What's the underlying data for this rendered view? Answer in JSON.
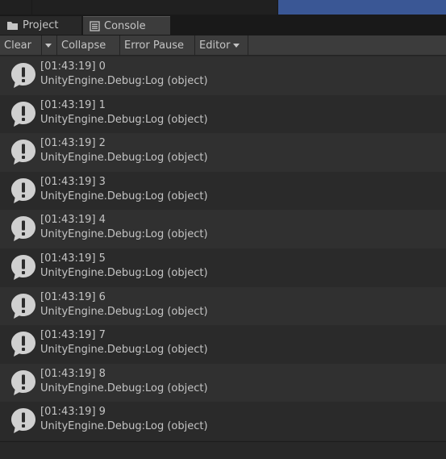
{
  "tabs": [
    {
      "label": "Project",
      "icon": "folder-icon",
      "active": false
    },
    {
      "label": "Console",
      "icon": "console-icon",
      "active": true
    }
  ],
  "toolbar": {
    "clear_label": "Clear",
    "collapse_label": "Collapse",
    "error_pause_label": "Error Pause",
    "editor_label": "Editor"
  },
  "logs": [
    {
      "line1": "[01:43:19] 0",
      "line2": "UnityEngine.Debug:Log (object)"
    },
    {
      "line1": "[01:43:19] 1",
      "line2": "UnityEngine.Debug:Log (object)"
    },
    {
      "line1": "[01:43:19] 2",
      "line2": "UnityEngine.Debug:Log (object)"
    },
    {
      "line1": "[01:43:19] 3",
      "line2": "UnityEngine.Debug:Log (object)"
    },
    {
      "line1": "[01:43:19] 4",
      "line2": "UnityEngine.Debug:Log (object)"
    },
    {
      "line1": "[01:43:19] 5",
      "line2": "UnityEngine.Debug:Log (object)"
    },
    {
      "line1": "[01:43:19] 6",
      "line2": "UnityEngine.Debug:Log (object)"
    },
    {
      "line1": "[01:43:19] 7",
      "line2": "UnityEngine.Debug:Log (object)"
    },
    {
      "line1": "[01:43:19] 8",
      "line2": "UnityEngine.Debug:Log (object)"
    },
    {
      "line1": "[01:43:19] 9",
      "line2": "UnityEngine.Debug:Log (object)"
    }
  ],
  "colors": {
    "background": "#282828",
    "toolbar": "#3c3c3c",
    "row_odd": "#303030",
    "row_even": "#2a2a2a",
    "text": "#c4c4c4",
    "accent_blue": "#3a5795"
  }
}
